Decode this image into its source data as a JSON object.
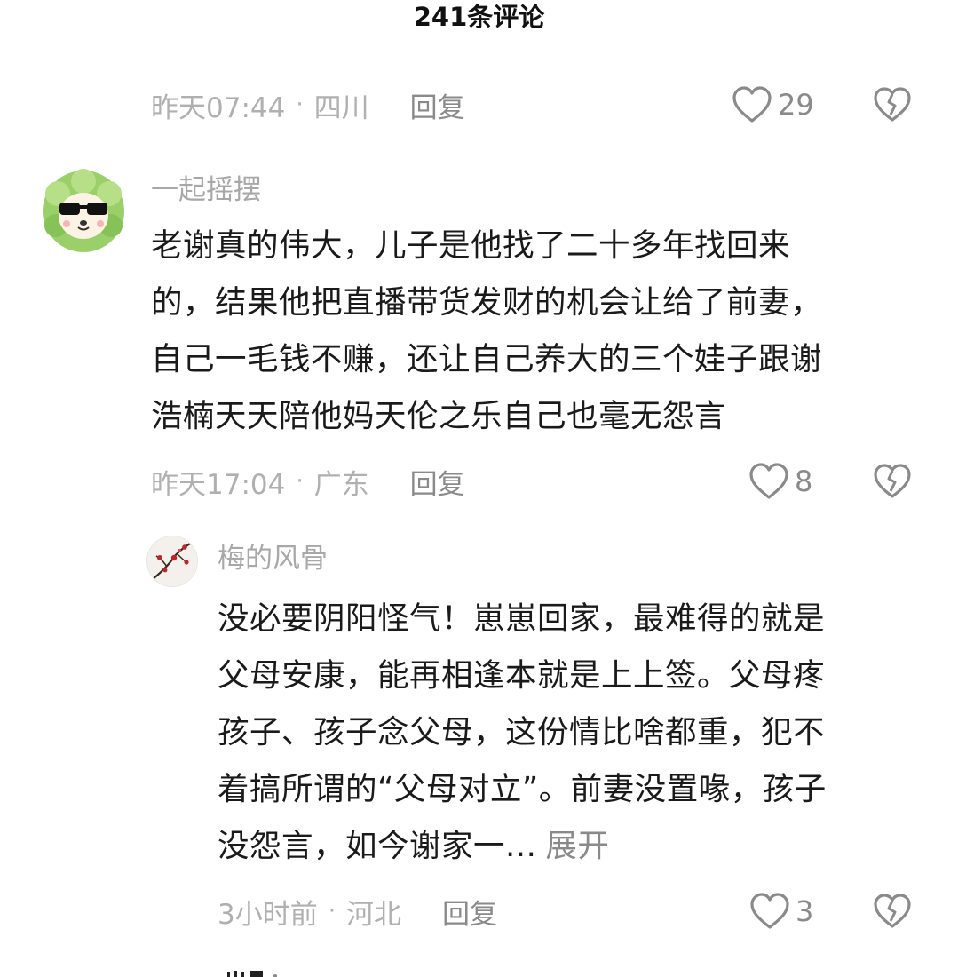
{
  "header": {
    "title": "241条评论"
  },
  "comments": [
    {
      "time": "昨天07:44",
      "location": "四川",
      "reply_label": "回复",
      "likes": "29"
    },
    {
      "username": "一起摇摆",
      "avatar_icon": "cabbage-dog-sunglasses-avatar",
      "lines": [
        "老谢真的伟大，儿子是他找了二十多年找回来",
        "的，结果他把直播带货发财的机会让给了前妻，",
        "自己一毛钱不赚，还让自己养大的三个娃子跟谢",
        "浩楠天天陪他妈天伦之乐自己也毫无怨言"
      ],
      "time": "昨天17:04",
      "location": "广东",
      "reply_label": "回复",
      "likes": "8"
    },
    {
      "username": "梅的风骨",
      "avatar_icon": "plum-blossom-avatar",
      "lines": [
        "没必要阴阳怪气！崽崽回家，最难得的就是",
        "父母安康，能再相逢本就是上上签。父母疼",
        "孩子、孩子念父母，这份情比啥都重，犯不",
        "着搞所谓的“父母对立”。前妻没置喙，孩子",
        "没怨言，如今谢家一..."
      ],
      "expand_label": "展开",
      "time": "3小时前",
      "location": "河北",
      "reply_label": "回复",
      "likes": "3"
    }
  ]
}
